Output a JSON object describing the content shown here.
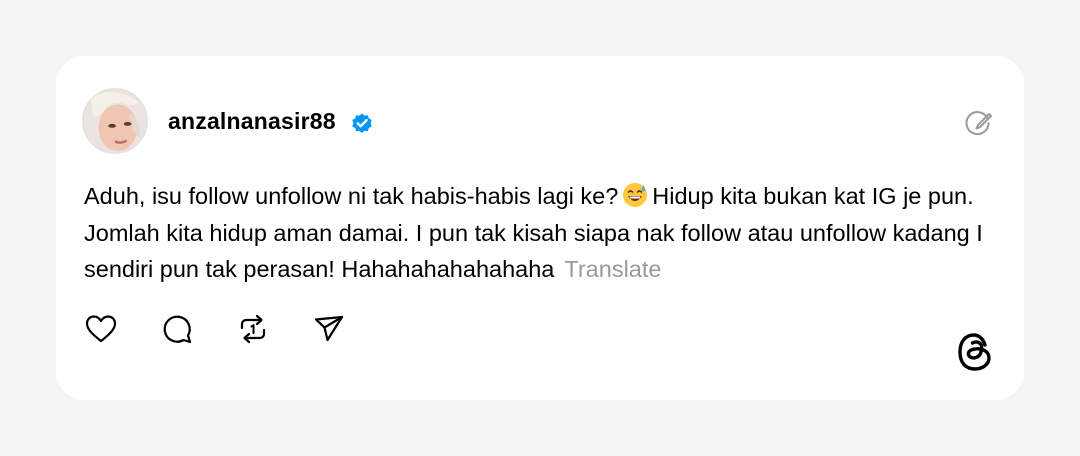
{
  "post": {
    "username": "anzalnanasir88",
    "verified": true,
    "text_part1": "Aduh, isu follow unfollow ni tak habis-habis lagi ke?",
    "emoji": "grinning-face-with-sweat",
    "text_part2": "Hidup kita bukan kat IG je pun. Jomlah kita hidup aman damai. I pun tak kisah siapa nak follow atau unfollow kadang I sendiri pun tak perasan! Hahahahahahahaha",
    "translate_label": "Translate"
  },
  "actions": [
    {
      "icon": "heart-icon"
    },
    {
      "icon": "comment-icon"
    },
    {
      "icon": "repost-icon"
    },
    {
      "icon": "share-icon"
    }
  ],
  "colors": {
    "background": "#f5f5f5",
    "card": "#ffffff",
    "verified_blue": "#0095f6",
    "muted_text": "#9a9a9a"
  }
}
